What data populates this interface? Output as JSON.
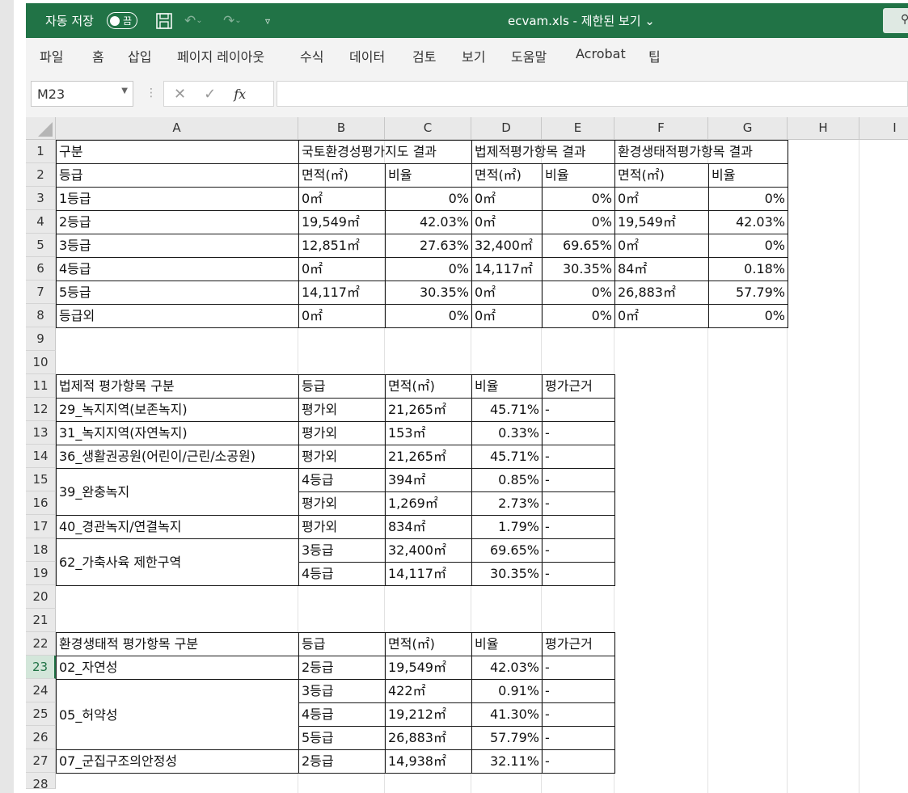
{
  "titlebar": {
    "autosave_label": "자동 저장",
    "autosave_state": "끔",
    "title": "ecvam.xls  -  제한된 보기 ⌄"
  },
  "ribbon": {
    "tabs": [
      "파일",
      "홈",
      "삽입",
      "페이지 레이아웃",
      "수식",
      "데이터",
      "검토",
      "보기",
      "도움말",
      "Acrobat",
      "팁"
    ]
  },
  "formula_bar": {
    "name_box": "M23",
    "formula": ""
  },
  "columns": [
    "A",
    "B",
    "C",
    "D",
    "E",
    "F",
    "G",
    "H",
    "I"
  ],
  "rows": [
    "1",
    "2",
    "3",
    "4",
    "5",
    "6",
    "7",
    "8",
    "9",
    "10",
    "11",
    "12",
    "13",
    "14",
    "15",
    "16",
    "17",
    "18",
    "19",
    "20",
    "21",
    "22",
    "23",
    "24",
    "25",
    "26",
    "27",
    "28"
  ],
  "table1": {
    "r1": [
      "구분",
      "국토환경성평가지도 결과",
      "법제적평가항목 결과",
      "환경생태적평가항목 결과"
    ],
    "r2": [
      "등급",
      "면적(㎡)",
      "비율",
      "면적(㎡)",
      "비율",
      "면적(㎡)",
      "비율"
    ],
    "rows": [
      [
        "1등급",
        "0㎡",
        "0%",
        "0㎡",
        "0%",
        "0㎡",
        "0%"
      ],
      [
        "2등급",
        "19,549㎡",
        "42.03%",
        "0㎡",
        "0%",
        "19,549㎡",
        "42.03%"
      ],
      [
        "3등급",
        "12,851㎡",
        "27.63%",
        "32,400㎡",
        "69.65%",
        "0㎡",
        "0%"
      ],
      [
        "4등급",
        "0㎡",
        "0%",
        "14,117㎡",
        "30.35%",
        "84㎡",
        "0.18%"
      ],
      [
        "5등급",
        "14,117㎡",
        "30.35%",
        "0㎡",
        "0%",
        "26,883㎡",
        "57.79%"
      ],
      [
        "등급외",
        "0㎡",
        "0%",
        "0㎡",
        "0%",
        "0㎡",
        "0%"
      ]
    ]
  },
  "table2": {
    "header": [
      "법제적 평가항목 구분",
      "등급",
      "면적(㎡)",
      "비율",
      "평가근거"
    ],
    "groups": [
      "29_녹지지역(보존녹지)",
      "31_녹지지역(자연녹지)",
      "36_생활권공원(어린이/근린/소공원)",
      "39_완충녹지",
      "40_경관녹지/연결녹지",
      "62_가축사육 제한구역"
    ],
    "rows": [
      [
        "평가외",
        "21,265㎡",
        "45.71%",
        "-"
      ],
      [
        "평가외",
        "153㎡",
        "0.33%",
        "-"
      ],
      [
        "평가외",
        "21,265㎡",
        "45.71%",
        "-"
      ],
      [
        "4등급",
        "394㎡",
        "0.85%",
        "-"
      ],
      [
        "평가외",
        "1,269㎡",
        "2.73%",
        "-"
      ],
      [
        "평가외",
        "834㎡",
        "1.79%",
        "-"
      ],
      [
        "3등급",
        "32,400㎡",
        "69.65%",
        "-"
      ],
      [
        "4등급",
        "14,117㎡",
        "30.35%",
        "-"
      ]
    ]
  },
  "table3": {
    "header": [
      "환경생태적 평가항목 구분",
      "등급",
      "면적(㎡)",
      "비율",
      "평가근거"
    ],
    "groups": [
      "02_자연성",
      "05_허약성",
      "07_군집구조의안정성"
    ],
    "rows": [
      [
        "2등급",
        "19,549㎡",
        "42.03%",
        "-"
      ],
      [
        "3등급",
        "422㎡",
        "0.91%",
        "-"
      ],
      [
        "4등급",
        "19,212㎡",
        "41.30%",
        "-"
      ],
      [
        "5등급",
        "26,883㎡",
        "57.79%",
        "-"
      ],
      [
        "2등급",
        "14,938㎡",
        "32.11%",
        "-"
      ]
    ]
  }
}
